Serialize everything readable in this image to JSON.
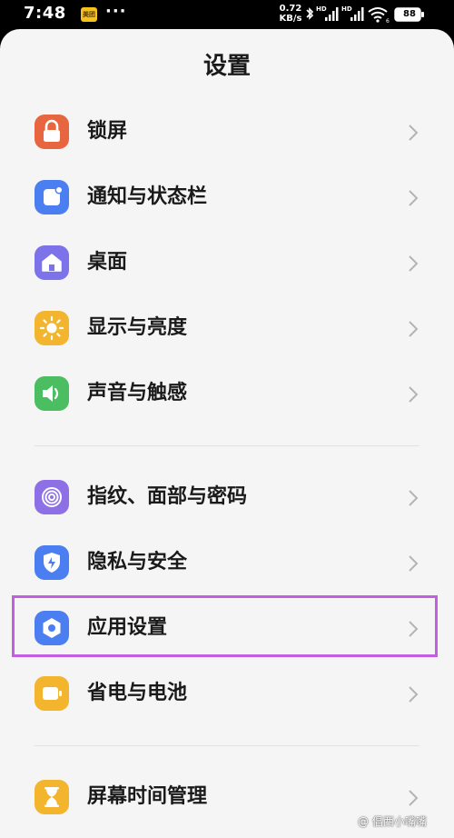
{
  "status_bar": {
    "time": "7:48",
    "app_badge": "美团",
    "more": "···",
    "net_speed_value": "0.72",
    "net_speed_unit": "KB/s",
    "battery": "88"
  },
  "page": {
    "title": "设置"
  },
  "settings": {
    "items": [
      {
        "label": "锁屏",
        "icon": "lock-icon",
        "color": "#e8663f"
      },
      {
        "label": "通知与状态栏",
        "icon": "notification-icon",
        "color": "#4b7ef0"
      },
      {
        "label": "桌面",
        "icon": "home-icon",
        "color": "#7c72ea"
      },
      {
        "label": "显示与亮度",
        "icon": "sun-icon",
        "color": "#f3b52e"
      },
      {
        "label": "声音与触感",
        "icon": "speaker-icon",
        "color": "#4bbe62"
      },
      {
        "label": "指纹、面部与密码",
        "icon": "fingerprint-icon",
        "color": "#8d6fe6"
      },
      {
        "label": "隐私与安全",
        "icon": "shield-icon",
        "color": "#4b7ef0"
      },
      {
        "label": "应用设置",
        "icon": "app-settings-icon",
        "color": "#4b7ef0"
      },
      {
        "label": "省电与电池",
        "icon": "battery-icon",
        "color": "#f3b52e"
      },
      {
        "label": "屏幕时间管理",
        "icon": "hourglass-icon",
        "color": "#f3b52e"
      }
    ]
  },
  "highlight_color": "#c35ee2",
  "watermark": "@ 倡西小嘴嘴"
}
